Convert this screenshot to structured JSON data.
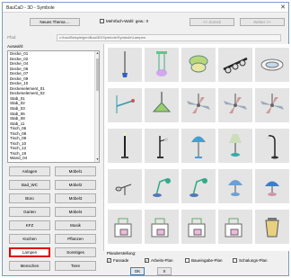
{
  "window": {
    "title": "BauCaD - 3D - Symbole",
    "close_glyph": "✕"
  },
  "toolbar": {
    "new_theme": "Neues Thema ...",
    "multi_select": "Mehrfach-Wahl: gew.: 0",
    "prev": "<< Zurück",
    "next": "Weiter >>"
  },
  "path": {
    "label": "Pfad:",
    "value": "c:\\bau\\Beispielgen\\Bau\\3D\\Symbole\\Symbole\\Lampen"
  },
  "selection_label": "Auswahl:",
  "list": {
    "items": [
      "Decke_01",
      "Decke_02",
      "Decke_04",
      "Decke_06",
      "Decke_07",
      "Decke_09",
      "Decke_10",
      "Deckenelement_01",
      "Deckenelement_02",
      "Stab_01",
      "Stab_02",
      "Stab_03",
      "Stab_06",
      "Stab_08",
      "Stab_11",
      "Tisch_06",
      "Tisch_08",
      "Tisch_09",
      "Tisch_10",
      "Tisch_12",
      "Tisch_19",
      "Wand_04"
    ]
  },
  "categories": [
    [
      "Anlagen",
      "Möbel1"
    ],
    [
      "Bad_WC",
      "Möbel2"
    ],
    [
      "Büro",
      "Möbel3"
    ],
    [
      "Garten",
      "Möbel4"
    ],
    [
      "KFZ",
      "Musik"
    ],
    [
      "Küchen",
      "Pflanzen"
    ],
    [
      "Lampen",
      "Sonstiges"
    ],
    [
      "Menschen",
      "Tiere"
    ]
  ],
  "active_category": "Lampen",
  "plans": {
    "label": "Planderstellung:",
    "items": [
      {
        "label": "Fassade",
        "checked": true
      },
      {
        "label": "Arbeits-Plan",
        "checked": true
      },
      {
        "label": "Baueingabe-Plan",
        "checked": false
      },
      {
        "label": "Schalungs-Plan",
        "checked": false
      }
    ]
  },
  "buttons": {
    "ok": "OK",
    "cancel": "X"
  },
  "symbols": [
    "hanging-lamp-icon",
    "pendant-lamp-icon",
    "ceiling-lamp-icon",
    "spotlight-rail-icon",
    "ceiling-disc-icon",
    "ceiling-arm-icon",
    "pendant-shade-icon",
    "ceiling-fan-icon",
    "ceiling-fan-icon",
    "ceiling-fan-icon",
    "floor-lamp-icon",
    "floor-lamp-arc-icon",
    "floor-lamp-globe-icon",
    "table-lamp-icon",
    "floor-lamp-curve-icon",
    "spotlight-icon",
    "desk-lamp-icon",
    "desk-lamp-icon",
    "table-lamp-shade-icon",
    "table-lamp-dome-icon",
    "wall-lamp-icon",
    "wall-lamp-icon",
    "wall-lamp-icon",
    "wall-lamp-icon",
    "lantern-icon"
  ]
}
